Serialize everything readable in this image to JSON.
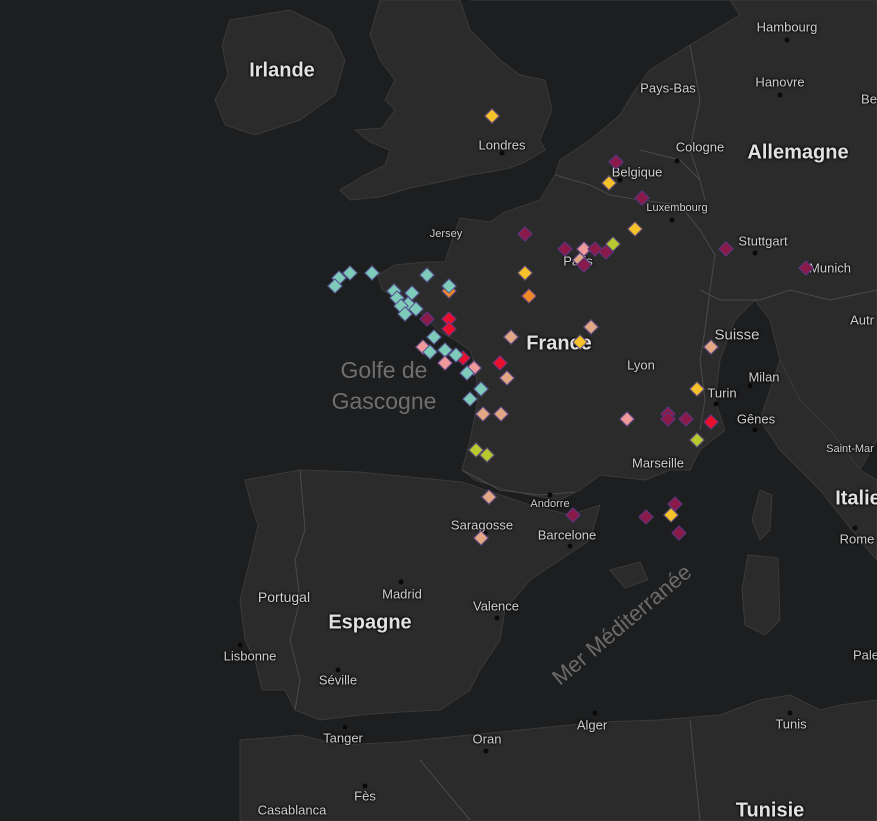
{
  "colors": {
    "sea": "#1d1e1f",
    "land": "#2b2b2b",
    "border": "#4a4a4a",
    "marker_palette": {
      "dark_magenta": "#8a1a4a",
      "red": "#e8102c",
      "orange": "#ef8a28",
      "yellow": "#f6c22a",
      "lime": "#b6c92e",
      "teal": "#7ecbb9",
      "pink": "#ee9a9a",
      "tan": "#e2a783"
    }
  },
  "labels": {
    "countries": {
      "irlande": "Irlande",
      "allemagne": "Allemagne",
      "france": "France",
      "suisse": "Suisse",
      "espagne": "Espagne",
      "portugal": "Portugal",
      "italie": "Italie",
      "tunisie": "Tunisie"
    },
    "seas": {
      "golfe": "Golfe de\nGascogne",
      "mediterranee": "Mer Méditerranée"
    },
    "cities": {
      "hambourg": "Hambourg",
      "hanovre": "Hanovre",
      "paysbas": "Pays-Bas",
      "londres": "Londres",
      "cologne": "Cologne",
      "belgique": "Belgique",
      "luxembourg": "Luxembourg",
      "jersey": "Jersey",
      "stuttgart": "Stuttgart",
      "munich": "Munich",
      "paris": "Paris",
      "lyon": "Lyon",
      "milan": "Milan",
      "turin": "Turin",
      "genes": "Gênes",
      "marseille": "Marseille",
      "saintmar": "Saint-Mar",
      "andorre": "Andorre",
      "saragosse": "Saragosse",
      "barcelone": "Barcelone",
      "rome": "Rome",
      "madrid": "Madrid",
      "valence": "Valence",
      "lisbonne": "Lisbonne",
      "seville": "Séville",
      "tanger": "Tanger",
      "oran": "Oran",
      "alger": "Alger",
      "tunis": "Tunis",
      "casablanca": "Casablanca",
      "fes": "Fès",
      "autr": "Autr",
      "be": "Be",
      "pale": "Pale"
    }
  },
  "markers": [
    {
      "lat": 51.5,
      "lon": 0.2,
      "c": "yellow"
    },
    {
      "lat": 50.6,
      "lon": 3.6,
      "c": "dark_magenta"
    },
    {
      "lat": 50.2,
      "lon": 3.4,
      "c": "yellow"
    },
    {
      "lat": 49.9,
      "lon": 4.3,
      "c": "dark_magenta"
    },
    {
      "lat": 49.2,
      "lon": 1.1,
      "c": "dark_magenta"
    },
    {
      "lat": 49.3,
      "lon": 4.1,
      "c": "yellow"
    },
    {
      "lat": 49.0,
      "lon": 3.5,
      "c": "lime"
    },
    {
      "lat": 48.9,
      "lon": 2.2,
      "c": "dark_magenta"
    },
    {
      "lat": 48.9,
      "lon": 2.7,
      "c": "pink"
    },
    {
      "lat": 48.9,
      "lon": 3.0,
      "c": "dark_magenta"
    },
    {
      "lat": 48.85,
      "lon": 3.3,
      "c": "dark_magenta"
    },
    {
      "lat": 48.7,
      "lon": 2.6,
      "c": "tan"
    },
    {
      "lat": 48.6,
      "lon": 2.7,
      "c": "dark_magenta"
    },
    {
      "lat": 48.9,
      "lon": 6.6,
      "c": "dark_magenta"
    },
    {
      "lat": 48.55,
      "lon": 8.8,
      "c": "dark_magenta"
    },
    {
      "lat": 48.45,
      "lon": 1.1,
      "c": "yellow"
    },
    {
      "lat": 48.0,
      "lon": 1.2,
      "c": "orange"
    },
    {
      "lat": 48.1,
      "lon": -1.0,
      "c": "orange"
    },
    {
      "lat": 48.4,
      "lon": -1.6,
      "c": "teal"
    },
    {
      "lat": 48.2,
      "lon": -1.0,
      "c": "teal"
    },
    {
      "lat": 47.4,
      "lon": 2.9,
      "c": "tan"
    },
    {
      "lat": 47.1,
      "lon": 2.6,
      "c": "yellow"
    },
    {
      "lat": 47.0,
      "lon": 6.2,
      "c": "tan"
    },
    {
      "lat": 47.2,
      "lon": 0.7,
      "c": "tan"
    },
    {
      "lat": 46.8,
      "lon": -0.6,
      "c": "red"
    },
    {
      "lat": 46.7,
      "lon": 0.4,
      "c": "red"
    },
    {
      "lat": 46.6,
      "lon": -0.3,
      "c": "pink"
    },
    {
      "lat": 46.4,
      "lon": 0.6,
      "c": "tan"
    },
    {
      "lat": 46.2,
      "lon": -0.1,
      "c": "teal"
    },
    {
      "lat": 48.35,
      "lon": -4.0,
      "c": "teal"
    },
    {
      "lat": 48.45,
      "lon": -3.7,
      "c": "teal"
    },
    {
      "lat": 48.45,
      "lon": -3.1,
      "c": "teal"
    },
    {
      "lat": 48.2,
      "lon": -4.1,
      "c": "teal"
    },
    {
      "lat": 48.1,
      "lon": -2.5,
      "c": "teal"
    },
    {
      "lat": 48.05,
      "lon": -2.0,
      "c": "teal"
    },
    {
      "lat": 47.95,
      "lon": -2.4,
      "c": "teal"
    },
    {
      "lat": 47.85,
      "lon": -2.1,
      "c": "teal"
    },
    {
      "lat": 47.8,
      "lon": -2.3,
      "c": "teal"
    },
    {
      "lat": 47.75,
      "lon": -1.9,
      "c": "teal"
    },
    {
      "lat": 47.65,
      "lon": -2.2,
      "c": "teal"
    },
    {
      "lat": 47.55,
      "lon": -1.6,
      "c": "dark_magenta"
    },
    {
      "lat": 47.55,
      "lon": -1.0,
      "c": "red"
    },
    {
      "lat": 47.35,
      "lon": -1.0,
      "c": "red"
    },
    {
      "lat": 47.2,
      "lon": -1.4,
      "c": "teal"
    },
    {
      "lat": 47.0,
      "lon": -1.7,
      "c": "pink"
    },
    {
      "lat": 46.9,
      "lon": -1.5,
      "c": "teal"
    },
    {
      "lat": 46.95,
      "lon": -1.1,
      "c": "teal"
    },
    {
      "lat": 46.85,
      "lon": -0.8,
      "c": "teal"
    },
    {
      "lat": 46.7,
      "lon": -1.1,
      "c": "pink"
    },
    {
      "lat": 46.5,
      "lon": -0.5,
      "c": "teal"
    },
    {
      "lat": 46.0,
      "lon": -0.4,
      "c": "teal"
    },
    {
      "lat": 45.7,
      "lon": -0.05,
      "c": "tan"
    },
    {
      "lat": 45.7,
      "lon": 0.45,
      "c": "tan"
    },
    {
      "lat": 45.6,
      "lon": 3.9,
      "c": "pink"
    },
    {
      "lat": 46.2,
      "lon": 5.8,
      "c": "yellow"
    },
    {
      "lat": 45.7,
      "lon": 5.0,
      "c": "dark_magenta"
    },
    {
      "lat": 45.6,
      "lon": 5.0,
      "c": "dark_magenta"
    },
    {
      "lat": 45.6,
      "lon": 5.5,
      "c": "dark_magenta"
    },
    {
      "lat": 45.55,
      "lon": 6.2,
      "c": "red"
    },
    {
      "lat": 45.2,
      "lon": 5.8,
      "c": "lime"
    },
    {
      "lat": 45.0,
      "lon": -0.25,
      "c": "lime"
    },
    {
      "lat": 44.9,
      "lon": 0.05,
      "c": "lime"
    },
    {
      "lat": 44.1,
      "lon": 0.1,
      "c": "tan"
    },
    {
      "lat": 43.75,
      "lon": 2.4,
      "c": "dark_magenta"
    },
    {
      "lat": 43.7,
      "lon": 4.4,
      "c": "dark_magenta"
    },
    {
      "lat": 43.95,
      "lon": 5.2,
      "c": "dark_magenta"
    },
    {
      "lat": 43.75,
      "lon": 5.1,
      "c": "yellow"
    },
    {
      "lat": 43.4,
      "lon": 5.3,
      "c": "dark_magenta"
    },
    {
      "lat": 43.3,
      "lon": -0.1,
      "c": "tan"
    }
  ]
}
